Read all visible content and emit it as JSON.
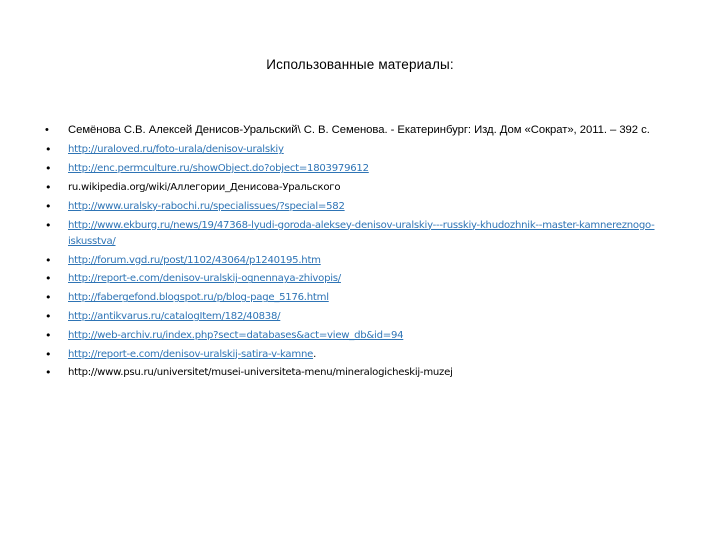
{
  "slide": {
    "title": "Использованные материалы:",
    "background_color": "#ffffff",
    "text_color": "#000000",
    "link_color": "#2E74B5",
    "items": [
      {
        "kind": "reference",
        "text": "Семёнова С.В. Алексей Денисов-Уральский\\ С. В. Семенова. - Екатеринбург: Изд. Дом «Сократ», 2011. – 392 с.",
        "is_link": false
      },
      {
        "kind": "url",
        "text": "http://uraloved.ru/foto-urala/denisov-uralskiy",
        "is_link": true
      },
      {
        "kind": "url",
        "text": "http://enc.permculture.ru/showObject.do?object=1803979612",
        "is_link": true
      },
      {
        "kind": "url",
        "text": "ru.wikipedia.org/wiki/Аллегории_Денисова-Уральского",
        "is_link": false
      },
      {
        "kind": "url",
        "text": "http://www.uralsky-rabochi.ru/specialissues/?special=582",
        "is_link": true
      },
      {
        "kind": "url",
        "text": "http://www.ekburg.ru/news/19/47368-lyudi-goroda-aleksey-denisov-uralskiy---russkiy-khudozhnik--master-kamnereznogo-iskusstva/",
        "is_link": true
      },
      {
        "kind": "url",
        "text": "http://forum.vgd.ru/post/1102/43064/p1240195.htm",
        "is_link": true
      },
      {
        "kind": "url",
        "text": "http://report-e.com/denisov-uralskij-ognennaya-zhivopis/",
        "is_link": true
      },
      {
        "kind": "url",
        "text": "http://fabergefond.blogspot.ru/p/blog-page_5176.html",
        "is_link": true
      },
      {
        "kind": "url",
        "text": "http://antikvarus.ru/catalogItem/182/40838/",
        "is_link": true
      },
      {
        "kind": "url",
        "text": "http://web-archiv.ru/index.php?sect=databases&act=view_db&id=94",
        "is_link": true
      },
      {
        "kind": "url",
        "text": "http://report-e.com/denisov-uralskij-satira-v-kamne",
        "is_link": true,
        "trailing": "."
      },
      {
        "kind": "url",
        "text": "http://www.psu.ru/universitet/musei-universiteta-menu/mineralogicheskij-muzej",
        "is_link": false
      }
    ]
  }
}
